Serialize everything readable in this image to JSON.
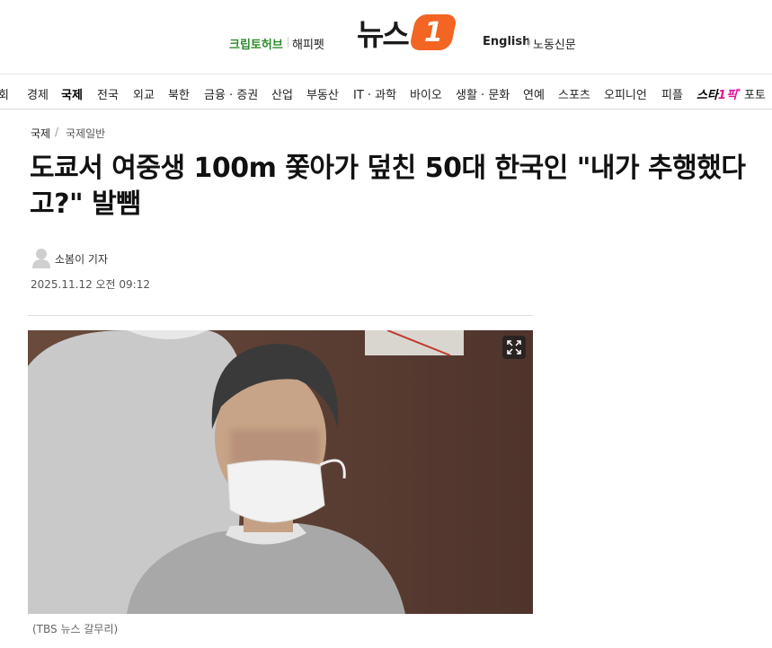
{
  "header": {
    "left_link_1": "크립토허브",
    "left_link_2": "해피펫",
    "logo_text": "뉴스",
    "logo_badge": "1",
    "right_link_1": "English",
    "right_link_2": "노동신문"
  },
  "nav": {
    "items": [
      "회",
      "경제",
      "국제",
      "전국",
      "외교",
      "북한",
      "금융 · 증권",
      "산업",
      "부동산",
      "IT · 과학",
      "바이오",
      "생활 · 문화",
      "연예",
      "스포츠",
      "오피니언",
      "피플",
      "포토"
    ],
    "star_label_a": "스타",
    "star_label_b": "1픽",
    "star_mark": "*"
  },
  "article": {
    "breadcrumb_main": "국제",
    "breadcrumb_sep": "/",
    "breadcrumb_sub": "국제일반",
    "headline": "도쿄서 여중생 100m 쫓아가 덮친 50대 한국인 \"내가 추행했다고?\" 발뺌",
    "reporter": "소봄이 기자",
    "date": "2025.11.12 오전 09:12",
    "photo_caption": "(TBS 뉴스 갈무리)"
  },
  "colors": {
    "brand_orange": "#f26522",
    "crypto_green": "#2e8b2e",
    "star_pink": "#e0119a"
  },
  "icons": {
    "avatar": "person-silhouette-icon",
    "expand": "expand-icon"
  }
}
